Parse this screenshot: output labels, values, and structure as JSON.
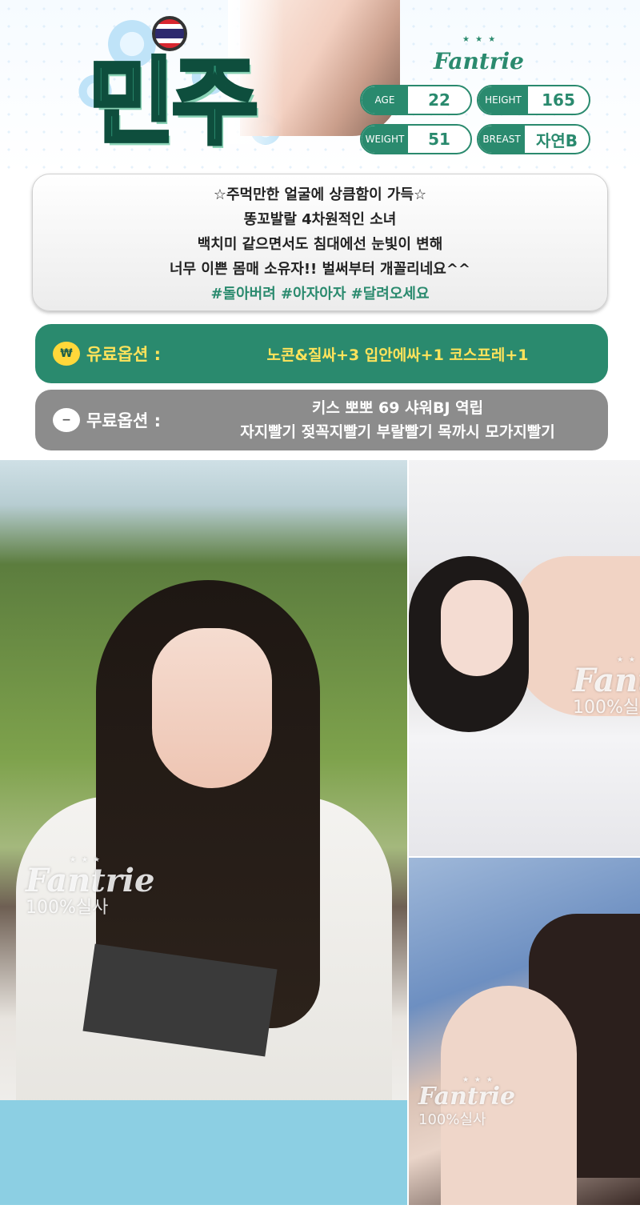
{
  "profile": {
    "name": "민주",
    "flag_icon": "thailand-flag-icon",
    "brand": "Fantrie",
    "stats": {
      "age_label": "AGE",
      "age_value": "22",
      "height_label": "HEIGHT",
      "height_value": "165",
      "weight_label": "WEIGHT",
      "weight_value": "51",
      "breast_label": "BREAST",
      "breast_value": "자연B"
    }
  },
  "intro": {
    "lines": [
      "☆주먹만한 얼굴에 상큼함이 가득☆",
      "똥꼬발랄 4차원적인 소녀",
      "백치미 같으면서도 침대에선 눈빛이 변해",
      "너무 이쁜 몸매 소유자!! 벌써부터 개꼴리네요^^"
    ],
    "tags": "#돌아버려 #아자아자 #달려오세요"
  },
  "options": {
    "paid": {
      "icon": "won-coin-icon",
      "badge": "₩",
      "label": "유료옵션 :",
      "text": "노콘&질싸+3 입안에싸+1 코스프레+1"
    },
    "free": {
      "icon": "minus-circle-icon",
      "badge": "−",
      "label": "무료옵션 :",
      "line1": "키스 뽀뽀 69 샤워BJ 역립",
      "line2": "자지빨기 젖꼭지빨기 부랄빨기 목까시 모가지빨기"
    }
  },
  "watermark": {
    "brand": "Fantrie",
    "sub": "100%실사",
    "stars": "★ ★ ★"
  },
  "colors": {
    "accent": "#2a8a6e",
    "paid_text": "#ffe35b",
    "free_bg": "#8c8c8c"
  }
}
